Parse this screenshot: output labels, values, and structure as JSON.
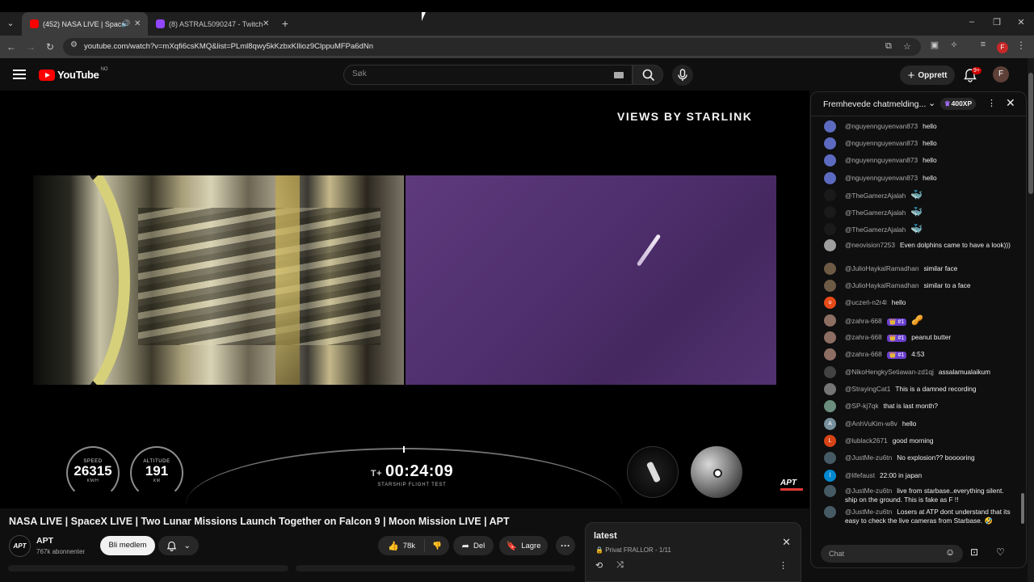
{
  "browser": {
    "tabs": [
      {
        "title": "(452) NASA LIVE | SpaceX LI",
        "active": true,
        "favicon_color": "#ff0000"
      },
      {
        "title": "(8) ASTRAL5090247 - Twitch",
        "active": false,
        "favicon_color": "#9146ff"
      }
    ],
    "url": "youtube.com/watch?v=mXqfi6csKMQ&list=PLml8qwy5kKzbxKIlioz9ClppuMFPa6dNn",
    "profile_initial": "F"
  },
  "youtube": {
    "logo_text": "YouTube",
    "country_code": "NO",
    "search_placeholder": "Søk",
    "create_label": "Opprett",
    "notifications_badge": "9+",
    "avatar_initial": "F"
  },
  "video": {
    "overlay_title": "VIEWS BY STARLINK",
    "speed_label": "SPEED",
    "speed_value": "26315",
    "speed_unit": "KM/H",
    "altitude_label": "ALTITUDE",
    "altitude_value": "191",
    "altitude_unit": "KM",
    "clock_prefix": "T+",
    "clock_value": "00:24:09",
    "clock_sub": "STARSHIP FLIGHT TEST",
    "channel_bug": "APT",
    "title": "NASA LIVE | SpaceX LIVE | Two Lunar Missions Launch Together on Falcon 9 | Moon Mission LIVE | APT"
  },
  "channel": {
    "avatar_text": "APT",
    "name": "APT",
    "subscribers": "767k abonnenter",
    "member_label": "Bli medlem"
  },
  "actions": {
    "likes": "78k",
    "share_label": "Del",
    "save_label": "Lagre"
  },
  "playlist": {
    "title": "latest",
    "meta": "Privat FRALLOR - 1/11"
  },
  "chat": {
    "mode_label": "Fremhevede chatmelding...",
    "xp_label": "400XP",
    "input_placeholder": "Chat",
    "messages": [
      {
        "author": "@nguyennguyenvan873",
        "text": "hello",
        "avatar_color": "#5c6bc0",
        "avatar_letter": ""
      },
      {
        "author": "@nguyennguyenvan873",
        "text": "hello",
        "avatar_color": "#5c6bc0",
        "avatar_letter": ""
      },
      {
        "author": "@nguyennguyenvan873",
        "text": "hello",
        "avatar_color": "#5c6bc0",
        "avatar_letter": ""
      },
      {
        "author": "@nguyennguyenvan873",
        "text": "hello",
        "avatar_color": "#5c6bc0",
        "avatar_letter": ""
      },
      {
        "author": "@TheGamerzAjalah",
        "text": "🐳",
        "avatar_color": "#1a1a1a",
        "avatar_letter": ""
      },
      {
        "author": "@TheGamerzAjalah",
        "text": "🐳",
        "avatar_color": "#1a1a1a",
        "avatar_letter": ""
      },
      {
        "author": "@TheGamerzAjalah",
        "text": "🐳",
        "avatar_color": "#1a1a1a",
        "avatar_letter": ""
      },
      {
        "author": "@neovision7253",
        "text": "Even dolphins came to have a look)))",
        "avatar_color": "#9e9e9e",
        "avatar_letter": ""
      },
      {
        "author": "@JulioHaykalRamadhan",
        "text": "similar face",
        "avatar_color": "#6d5a45",
        "avatar_letter": ""
      },
      {
        "author": "@JulioHaykalRamadhan",
        "text": "similar to a face",
        "avatar_color": "#6d5a45",
        "avatar_letter": ""
      },
      {
        "author": "@uczeń-n2r4l",
        "text": "hello",
        "avatar_color": "#e64a19",
        "avatar_letter": "u"
      },
      {
        "author": "@zahra-668",
        "badge": "👑 #1",
        "text": "🥜",
        "avatar_color": "#8d6e63",
        "avatar_letter": ""
      },
      {
        "author": "@zahra-668",
        "badge": "👑 #1",
        "text": "peanut butter",
        "avatar_color": "#8d6e63",
        "avatar_letter": ""
      },
      {
        "author": "@zahra-668",
        "badge": "👑 #1",
        "text": "4:53",
        "avatar_color": "#8d6e63",
        "avatar_letter": ""
      },
      {
        "author": "@NikoHengkySetiawan-zd1qj",
        "text": "assalamualaikum",
        "avatar_color": "#424242",
        "avatar_letter": ""
      },
      {
        "author": "@StrayingCat1",
        "text": "This is a damned recording",
        "avatar_color": "#757575",
        "avatar_letter": ""
      },
      {
        "author": "@SP-kj7qk",
        "text": "that is last month?",
        "avatar_color": "#6b8e7f",
        "avatar_letter": ""
      },
      {
        "author": "@AnhVuKim-w8v",
        "text": "hello",
        "avatar_color": "#78909c",
        "avatar_letter": "A"
      },
      {
        "author": "@lublack2671",
        "text": "good morning",
        "avatar_color": "#d84315",
        "avatar_letter": "L"
      },
      {
        "author": "@JustMe-zu6tn",
        "text": "No explosion?? booooring",
        "avatar_color": "#455a64",
        "avatar_letter": ""
      },
      {
        "author": "@lifefaust",
        "text": "22:00 in japan",
        "avatar_color": "#0288d1",
        "avatar_letter": "l"
      },
      {
        "author": "@JustMe-zu6tn",
        "text": "live from starbase..everything silent. ship on the ground. This is fake as F !!",
        "avatar_color": "#455a64",
        "avatar_letter": ""
      },
      {
        "author": "@JustMe-zu6tn",
        "text": "Losers at ATP dont understand that its easy to check the live cameras from Starbase. 🤣",
        "avatar_color": "#455a64",
        "avatar_letter": ""
      }
    ]
  }
}
